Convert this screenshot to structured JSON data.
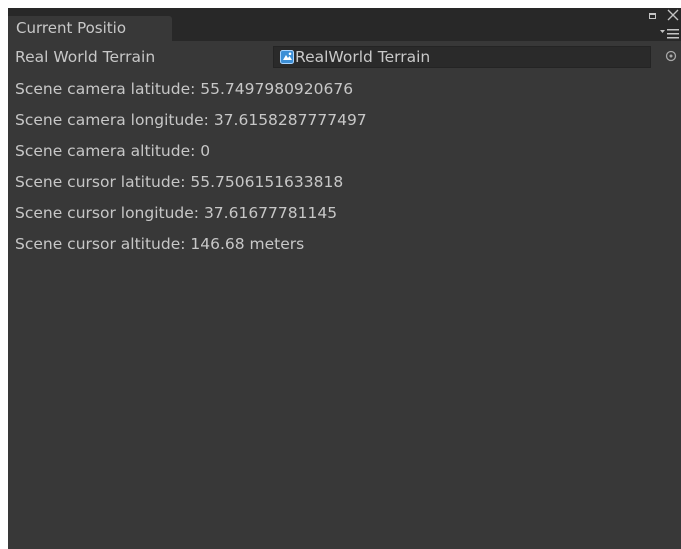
{
  "window": {
    "tab_title": "Current Positio"
  },
  "icons": {
    "maximize": "maximize-icon",
    "close": "close-icon",
    "menu": "menu-icon",
    "object": "realworld-terrain-object-icon",
    "picker": "object-picker-icon"
  },
  "field": {
    "label": "Real World Terrain",
    "value": "RealWorld Terrain"
  },
  "info_lines": [
    "Scene camera latitude: 55.7497980920676",
    "Scene camera longitude: 37.6158287777497",
    "Scene camera altitude: 0",
    "Scene cursor latitude: 55.7506151633818",
    "Scene cursor longitude: 37.61677781145",
    "Scene cursor altitude: 146.68 meters"
  ],
  "colors": {
    "panel_bg": "#383838",
    "tabbar_bg": "#282828",
    "text": "#c7c7c7",
    "field_bg": "#2a2a2a",
    "icon_accent": "#3c8fd6"
  }
}
